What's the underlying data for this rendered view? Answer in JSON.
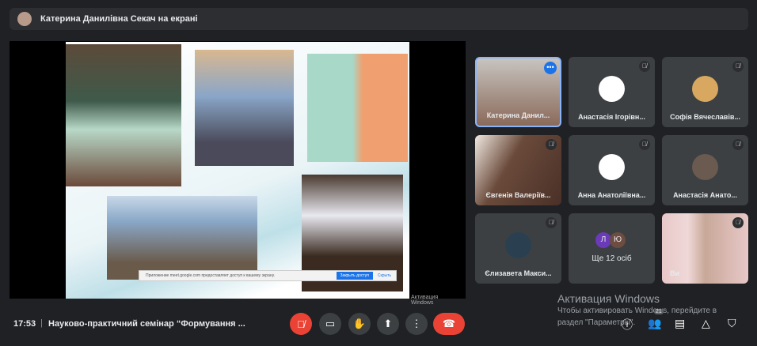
{
  "topbar": {
    "presenter_label": "Катерина Данилівна Секач на екрані"
  },
  "slide": {
    "share_banner": {
      "text": "Приложение meet.google.com предоставляет доступ к вашему экрану.",
      "stop_button": "Закрыть доступ",
      "hide_link": "Скрыть"
    },
    "watermark": "Активация Windows"
  },
  "participants": [
    {
      "name": "Катерина Данил...",
      "muted": false,
      "selected": true
    },
    {
      "name": "Анастасія Ігорівн...",
      "muted": true
    },
    {
      "name": "Софія Вячеславів...",
      "muted": true
    },
    {
      "name": "Євгенія Валеріїв...",
      "muted": true
    },
    {
      "name": "Анна Анатоліївна...",
      "muted": true
    },
    {
      "name": "Анастасія Анато...",
      "muted": true
    },
    {
      "name": "Єлизавета Макси...",
      "muted": true
    },
    {
      "name": "Ще 12 осіб",
      "initials": [
        "Л",
        "Ю"
      ]
    },
    {
      "name": "Ви",
      "muted": true
    }
  ],
  "bottombar": {
    "time": "17:53",
    "separator": "|",
    "meeting_title": "Науково-практичний семінар “Формування ...",
    "participant_count": "21"
  },
  "windows_watermark": {
    "title": "Активация Windows",
    "line1": "Чтобы активировать Windows, перейдите в",
    "line2": "раздел \"Параметры\"."
  },
  "colors": {
    "accent": "#1a73e8",
    "danger": "#ea4335",
    "bg": "#202124"
  }
}
